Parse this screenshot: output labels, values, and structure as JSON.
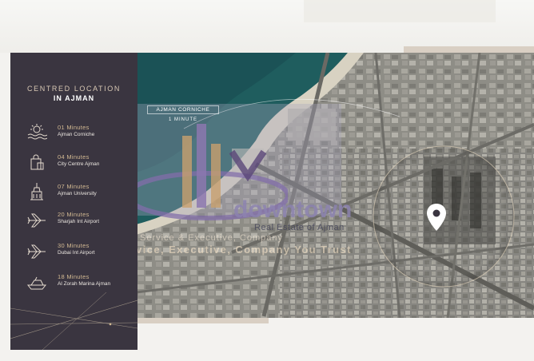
{
  "panel": {
    "heading": "CENTRED LOCATION",
    "subheading": "IN AJMAN",
    "items": [
      {
        "time": "01 Minutes",
        "place": "Ajman Corniche",
        "icon": "beach-icon"
      },
      {
        "time": "04 Minutes",
        "place": "City Centre Ajman",
        "icon": "shopping-bag-icon"
      },
      {
        "time": "07 Minutes",
        "place": "Ajman University",
        "icon": "university-icon"
      },
      {
        "time": "20 Minutes",
        "place": "Sharjah Int Airport",
        "icon": "airplane-icon"
      },
      {
        "time": "30 Minutes",
        "place": "Dubai Int Airport",
        "icon": "airplane-icon"
      },
      {
        "time": "18 Minutes",
        "place": "Al Zorah Marina Ajman",
        "icon": "yacht-icon"
      }
    ]
  },
  "callout": {
    "title": "AJMAN CORNICHE",
    "time": "1 MINUTE"
  },
  "watermark": {
    "brand": "downtown",
    "brand_sub": "Real Estate of Ajman",
    "tagline_1": "Service & Executive, Company",
    "tagline_2": "Service, Executive, Company You Trust"
  },
  "colors": {
    "panel": "#3a3540",
    "accent": "#d2b992",
    "frame": "#d9cfc3"
  }
}
